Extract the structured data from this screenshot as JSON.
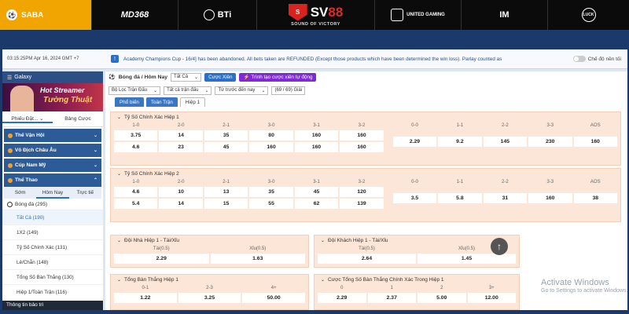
{
  "topbar": {
    "providers": [
      "SABA",
      "MD368",
      "BTi",
      "UNITED GAMING",
      "IM",
      "LUCK"
    ],
    "sv88": {
      "name_a": "SV",
      "name_b": "88",
      "slogan": "SOUND OF VICTORY"
    }
  },
  "notice": {
    "time": "03:15:25PM Apr 16, 2024 GMT +7",
    "message": "Academy Champions Cup - 16/4] has been abandoned. All bets taken are REFUNDED (Except those products which have been determined the win loss). Parlay counted as",
    "toggle_label": "Chế độ nền tối"
  },
  "sidebar": {
    "galaxy": "Galaxy",
    "banner": {
      "line1": "Hot Streamer",
      "line2": "Tường Thuật"
    },
    "tabs": [
      "Phiếu Đặt...",
      "Bảng Cược"
    ],
    "categories": [
      "Thế Vận Hội",
      "Vô Địch Châu Âu",
      "Cúp Nam Mỹ"
    ],
    "sports_header": "Thể Thao",
    "subtabs": [
      "Sớm",
      "Hôm Nay",
      "Trực tiế"
    ],
    "sport_item": "Bóng đá (295)",
    "markets": [
      "Tất Cả (190)",
      "1X2 (149)",
      "Tỷ Số Chính Xác (131)",
      "Lẻ/Chẵn (148)",
      "Tổng Số Bàn Thắng (130)",
      "Hiệp 1/Toàn Trận (116)"
    ],
    "info": "Thông tin bảo trì"
  },
  "main": {
    "title": "Bóng đá / Hôm Nay",
    "select_all": "Tất Cả",
    "btn_xien": "Cược Xiên",
    "btn_auto": "Trình tạo cược xiên tự động",
    "filters": [
      "Bộ Lọc Trận Đấu",
      "Tất cả trận đấu",
      "Từ trước đến nay",
      "(69 / 69) Giải"
    ],
    "tabs": [
      "Phổ biến",
      "Toàn Trận",
      "Hiệp 1"
    ]
  },
  "panels": {
    "p1": {
      "title": "Tỷ Số Chính Xác Hiệp 1",
      "left_labels": [
        "1-0",
        "2-0",
        "2-1",
        "3-0",
        "3-1",
        "3-2"
      ],
      "left_rows": [
        [
          "3.75",
          "14",
          "35",
          "80",
          "160",
          "160"
        ],
        [
          "4.6",
          "23",
          "45",
          "160",
          "160",
          "160"
        ]
      ],
      "right_labels": [
        "0-0",
        "1-1",
        "2-2",
        "3-3",
        "AOS"
      ],
      "right_row": [
        "2.29",
        "9.2",
        "145",
        "230",
        "160"
      ]
    },
    "p2": {
      "title": "Tỷ Số Chính Xác Hiệp 2",
      "left_labels": [
        "1-0",
        "2-0",
        "2-1",
        "3-0",
        "3-1",
        "3-2"
      ],
      "left_rows": [
        [
          "4.6",
          "10",
          "13",
          "35",
          "45",
          "120"
        ],
        [
          "5.4",
          "14",
          "15",
          "55",
          "62",
          "139"
        ]
      ],
      "right_labels": [
        "0-0",
        "1-1",
        "2-2",
        "3-3",
        "AOS"
      ],
      "right_row": [
        "3.5",
        "5.8",
        "31",
        "160",
        "38"
      ]
    },
    "p3": {
      "title": "Đội Nhà Hiệp 1 - Tài/Xỉu",
      "labels": [
        "Tài(0.5)",
        "Xỉu(0.5)"
      ],
      "values": [
        "2.29",
        "1.63"
      ]
    },
    "p4": {
      "title": "Đội Khách Hiệp 1 - Tài/Xỉu",
      "labels": [
        "Tài(0.5)",
        "Xỉu(0.5)"
      ],
      "values": [
        "2.64",
        "1.45"
      ]
    },
    "p5": {
      "title": "Tổng Bàn Thắng Hiệp 1",
      "labels": [
        "0-1",
        "2-3",
        "4+"
      ],
      "values": [
        "1.22",
        "3.25",
        "50.00"
      ]
    },
    "p6": {
      "title": "Cược Tổng Số Bàn Thắng Chính Xác Trong Hiệp 1",
      "labels": [
        "0",
        "1",
        "2",
        "3+"
      ],
      "values": [
        "2.29",
        "2.37",
        "5.00",
        "12.00"
      ]
    }
  },
  "watermark": {
    "title": "Activate Windows",
    "sub": "Go to Settings to activate Windows."
  },
  "scroll_top": "↑"
}
